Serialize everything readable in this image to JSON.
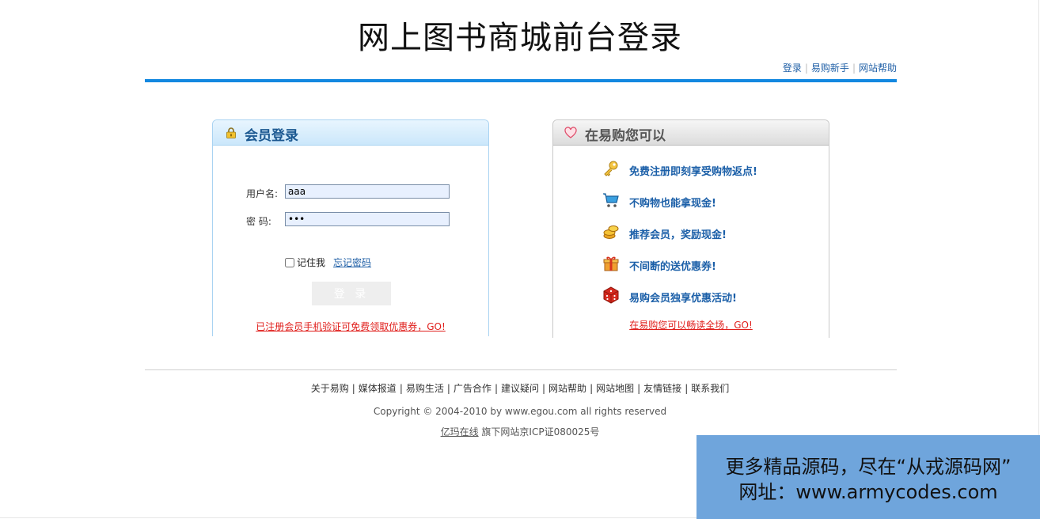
{
  "header": {
    "title": "网上图书商城前台登录",
    "links": [
      "登录",
      "易购新手",
      "网站帮助"
    ]
  },
  "login": {
    "title": "会员登录",
    "username_label": "用户名:",
    "username_value": "aaa",
    "password_label": "密 码:",
    "password_value": "aaa",
    "remember_label": "记住我",
    "forgot_label": "忘记密码",
    "login_button": "登 录",
    "promo_link": "已注册会员手机验证可免费领取优惠券，GO!"
  },
  "benefits": {
    "title": "在易购您可以",
    "items": [
      {
        "icon": "key-icon",
        "text": "免费注册即刻享受购物返点!"
      },
      {
        "icon": "cart-icon",
        "text": "不购物也能拿现金!"
      },
      {
        "icon": "coins-icon",
        "text": "推荐会员，奖励现金!"
      },
      {
        "icon": "gift-icon",
        "text": "不间断的送优惠券!"
      },
      {
        "icon": "dice-icon",
        "text": "易购会员独享优惠活动!"
      }
    ],
    "link": "在易购您可以畅读全场，GO!"
  },
  "footer": {
    "links": [
      "关于易购",
      "媒体报道",
      "易购生活",
      "广告合作",
      "建议疑问",
      "网站帮助",
      "网站地图",
      "友情链接",
      "联系我们"
    ],
    "copyright": "Copyright © 2004-2010 by www.egou.com all rights reserved",
    "icp_link": "亿玛在线",
    "icp_text": " 旗下网站京ICP证080025号"
  },
  "watermark": {
    "line1": "更多精品源码，尽在“从戎源码网”",
    "line2": "网址：www.armycodes.com"
  },
  "colors": {
    "accent_bar": "#1388e0",
    "link_blue": "#1f5fa6",
    "promo_red": "#e0201d",
    "watermark_bg": "#6fa5dc"
  }
}
